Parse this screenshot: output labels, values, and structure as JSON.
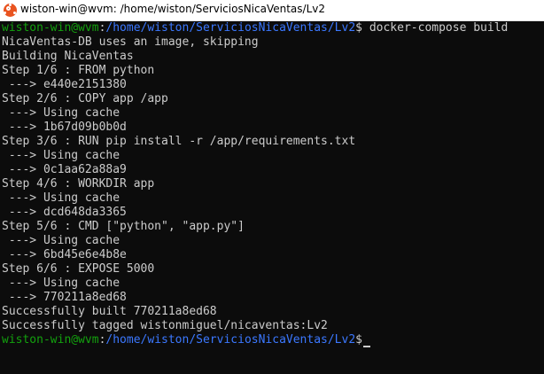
{
  "window": {
    "title": "wiston-win@wvm: /home/wiston/ServiciosNicaVentas/Lv2",
    "icon": "ubuntu-logo-icon",
    "icon_color": "#e95420"
  },
  "colors": {
    "background": "#0c0c0c",
    "text": "#cccccc",
    "prompt_user": "#13a10e",
    "prompt_path": "#3b78ff"
  },
  "prompt": {
    "user_host": "wiston-win@wvm",
    "separator": ":",
    "path": "/home/wiston/ServiciosNicaVentas/Lv2",
    "symbol": "$"
  },
  "command": " docker-compose build",
  "output": [
    "NicaVentas-DB uses an image, skipping",
    "Building NicaVentas",
    "Step 1/6 : FROM python",
    " ---> e440e2151380",
    "Step 2/6 : COPY app /app",
    " ---> Using cache",
    " ---> 1b67d09b0b0d",
    "Step 3/6 : RUN pip install -r /app/requirements.txt",
    " ---> Using cache",
    " ---> 0c1aa62a88a9",
    "Step 4/6 : WORKDIR app",
    " ---> Using cache",
    " ---> dcd648da3365",
    "Step 5/6 : CMD [\"python\", \"app.py\"]",
    " ---> Using cache",
    " ---> 6bd45e6e4b8e",
    "Step 6/6 : EXPOSE 5000",
    " ---> Using cache",
    " ---> 770211a8ed68",
    "Successfully built 770211a8ed68",
    "Successfully tagged wistonmiguel/nicaventas:Lv2"
  ]
}
